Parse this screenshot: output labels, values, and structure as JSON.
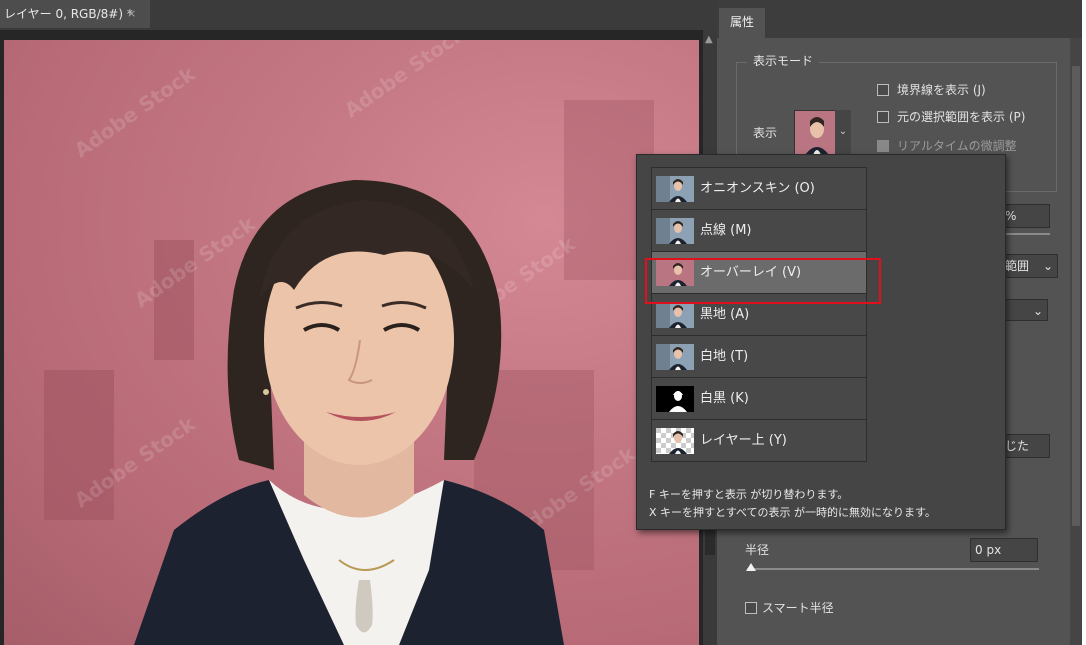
{
  "document": {
    "tab_title": "レイヤー 0, RGB/8#) *",
    "close_glyph": "×"
  },
  "canvas": {
    "watermark_text": "Adobe Stock",
    "overlay_color": "#c47883"
  },
  "panel": {
    "tab_label": "属性",
    "view_mode_title": "表示モード",
    "view_label": "表示",
    "show_edge_label": "境界線を表示 (J)",
    "show_original_label": "元の選択範囲を表示 (P)",
    "realtime_label": "リアルタイムの微調整",
    "percent_field_value": "%",
    "range_dropdown_value": "範囲",
    "close_button_fragment": "じた",
    "radius_label": "半径",
    "radius_value": "0 px",
    "smart_radius_label": "スマート半径",
    "realtime_checked": true
  },
  "view_menu": {
    "items": [
      {
        "label": "オニオンスキン (O)",
        "thumb": "photo-thumbnail"
      },
      {
        "label": "点線 (M)",
        "thumb": "photo-thumbnail"
      },
      {
        "label": "オーバーレイ (V)",
        "thumb": "overlay-thumbnail",
        "selected": true
      },
      {
        "label": "黒地 (A)",
        "thumb": "photo-thumbnail"
      },
      {
        "label": "白地 (T)",
        "thumb": "photo-thumbnail"
      },
      {
        "label": "白黒 (K)",
        "thumb": "mask-thumbnail"
      },
      {
        "label": "レイヤー上 (Y)",
        "thumb": "transparency-thumbnail"
      }
    ],
    "note_line1": "F キーを押すと表示 が切り替わります。",
    "note_line2": "X キーを押すとすべての表示 が一時的に無効になります。",
    "highlight_color": "#e0101c"
  }
}
